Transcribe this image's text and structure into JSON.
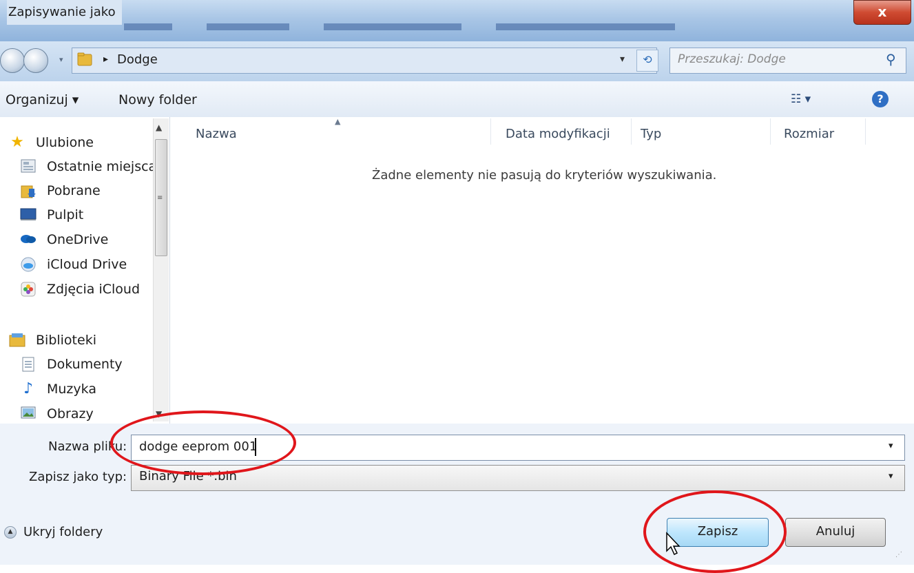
{
  "window": {
    "title": "Zapisywanie jako",
    "close_glyph": "x"
  },
  "navbar": {
    "path_arrow": "▸",
    "path": "Dodge",
    "dropdown_glyph": "▾",
    "refresh_glyph": "⟲",
    "search_placeholder": "Przeszukaj: Dodge",
    "search_glyph": "⚲"
  },
  "toolbar": {
    "organize": "Organizuj ▾",
    "new_folder": "Nowy folder",
    "views": "☷ ▾",
    "help_glyph": "?"
  },
  "sidebar": {
    "favorites": [
      {
        "label": "Ulubione",
        "icon": "star-icon"
      },
      {
        "label": "Ostatnie miejsca",
        "icon": "recent-places-icon"
      },
      {
        "label": "Pobrane",
        "icon": "downloads-icon"
      },
      {
        "label": "Pulpit",
        "icon": "desktop-icon"
      },
      {
        "label": "OneDrive",
        "icon": "onedrive-icon"
      },
      {
        "label": "iCloud Drive",
        "icon": "icloud-drive-icon"
      },
      {
        "label": "Zdjęcia iCloud",
        "icon": "icloud-photos-icon"
      }
    ],
    "libraries": [
      {
        "label": "Biblioteki",
        "icon": "libraries-icon"
      },
      {
        "label": "Dokumenty",
        "icon": "documents-icon"
      },
      {
        "label": "Muzyka",
        "icon": "music-icon"
      },
      {
        "label": "Obrazy",
        "icon": "pictures-icon"
      }
    ]
  },
  "columns": {
    "name": "Nazwa",
    "date": "Data modyfikacji",
    "type": "Typ",
    "size": "Rozmiar"
  },
  "empty_message": "Żadne elementy nie pasują do kryteriów wyszukiwania.",
  "form": {
    "filename_label": "Nazwa pliku:",
    "filename_value": "dodge eeprom 001",
    "filetype_label": "Zapisz jako typ:",
    "filetype_value": "Binary File *.bin"
  },
  "buttons": {
    "hide_folders": "Ukryj foldery",
    "save": "Zapisz",
    "cancel": "Anuluj"
  },
  "colors": {
    "annotation": "#e0161b",
    "accent": "#3c7fb1"
  }
}
